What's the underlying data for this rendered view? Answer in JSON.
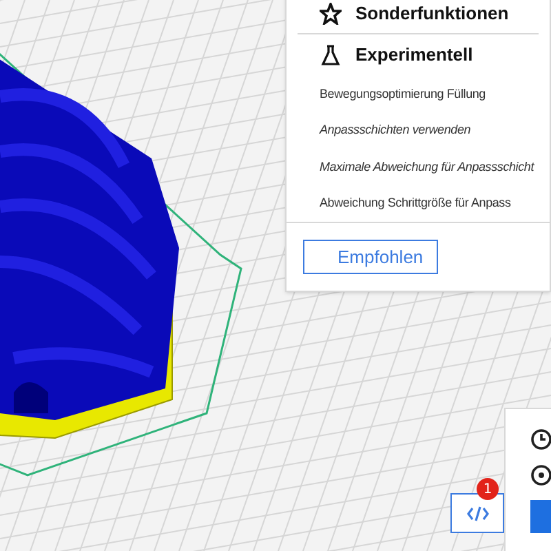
{
  "settings_panel": {
    "categories": [
      {
        "label": "Sonderfunktionen",
        "kind": "star"
      },
      {
        "label": "Experimentell",
        "kind": "flask"
      }
    ],
    "settings": [
      {
        "label": "Bewegungsoptimierung Füllung",
        "italic": false
      },
      {
        "label": "Anpassschichten verwenden",
        "italic": true
      },
      {
        "label": "Maximale Abweichung für Anpassschicht",
        "italic": true
      },
      {
        "label": "Abweichung Schrittgröße für Anpass",
        "italic": false
      }
    ],
    "recommended_button": "Empfohlen"
  },
  "code_button": {
    "badge": "1"
  }
}
